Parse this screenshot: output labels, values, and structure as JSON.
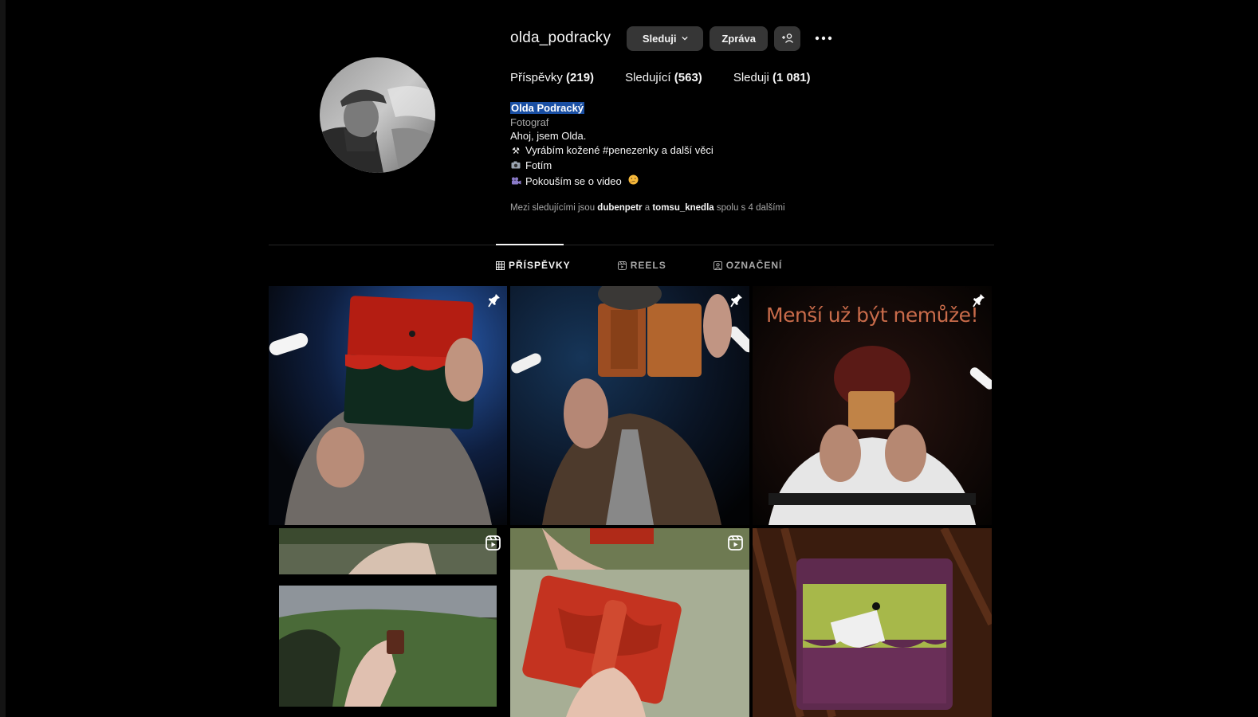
{
  "profile": {
    "username": "olda_podracky",
    "follow_button": "Sleduji",
    "message_button": "Zpráva",
    "stats": {
      "posts_label": "Příspěvky",
      "posts_count": "(219)",
      "followers_label": "Sledující",
      "followers_count": "(563)",
      "following_label": "Sleduji",
      "following_count": "(1 081)"
    },
    "bio": {
      "name": "Olda Podracký",
      "category": "Fotograf",
      "line1": "Ahoj, jsem Olda.",
      "line2": "Vyrábím kožené #penezenky a další věci",
      "line3": "Fotím",
      "line4": "Pokouším se o video"
    },
    "followed_by": {
      "prefix": "Mezi sledujícími jsou",
      "user1": "dubenpetr",
      "conj": "a",
      "user2": "tomsu_knedla",
      "suffix": "spolu s 4 dalšími"
    }
  },
  "tabs": [
    {
      "label": "PŘÍSPĚVKY",
      "icon": "grid-icon",
      "active": true
    },
    {
      "label": "REELS",
      "icon": "reels-icon",
      "active": false
    },
    {
      "label": "OZNAČENÍ",
      "icon": "tagged-icon",
      "active": false
    }
  ],
  "posts": [
    {
      "type": "pinned",
      "subject": "red-green wallet"
    },
    {
      "type": "pinned",
      "subject": "brown card wallet"
    },
    {
      "type": "pinned",
      "subject": "small wallet",
      "overlay_text": "Menší už být nemůže!"
    },
    {
      "type": "reel",
      "subject": "hand with wallet over landscape"
    },
    {
      "type": "reel",
      "subject": "red card wallet"
    },
    {
      "type": "post",
      "subject": "purple-green wallet"
    }
  ],
  "colors": {
    "background": "#000000",
    "button": "#363636",
    "highlight": "#1a4fa3",
    "secondary_text": "#a8a8a8",
    "overlay_text": "#c86b4a"
  }
}
